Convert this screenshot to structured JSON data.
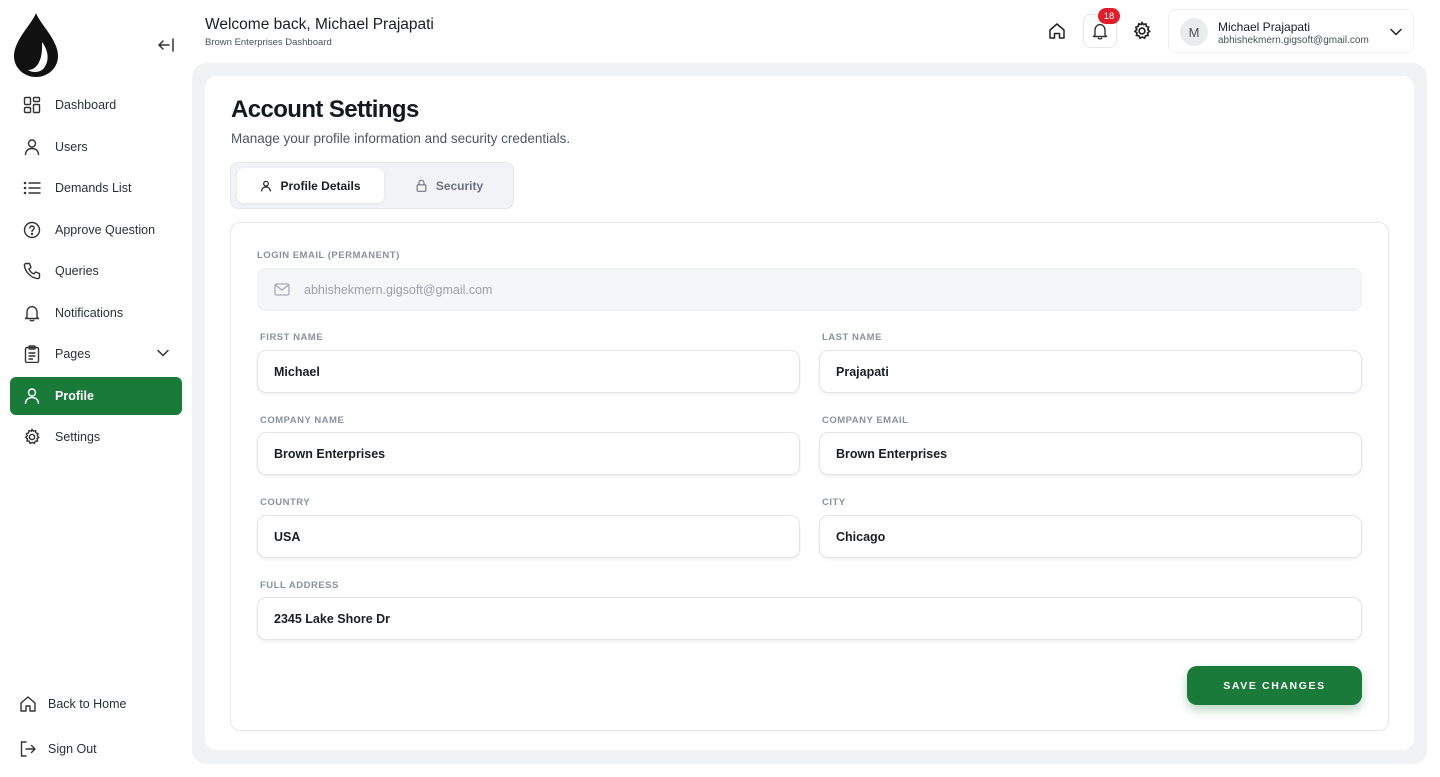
{
  "colors": {
    "accent": "#1a7a3a",
    "badge": "#e11d2a"
  },
  "sidebar": {
    "items": [
      {
        "label": "Dashboard",
        "icon": "grid-icon"
      },
      {
        "label": "Users",
        "icon": "user-icon"
      },
      {
        "label": "Demands List",
        "icon": "list-icon"
      },
      {
        "label": "Approve Question",
        "icon": "question-icon"
      },
      {
        "label": "Queries",
        "icon": "phone-icon"
      },
      {
        "label": "Notifications",
        "icon": "bell-icon"
      },
      {
        "label": "Pages",
        "icon": "clipboard-icon"
      },
      {
        "label": "Profile",
        "icon": "user-icon",
        "active": true
      },
      {
        "label": "Settings",
        "icon": "gear-icon"
      }
    ],
    "back_home": "Back to Home",
    "sign_out": "Sign Out"
  },
  "header": {
    "welcome": "Welcome back, Michael Prajapati",
    "subtitle": "Brown Enterprises Dashboard",
    "notification_count": "18",
    "user": {
      "initial": "M",
      "name": "Michael Prajapati",
      "email": "abhishekmern.gigsoft@gmail.com"
    }
  },
  "page": {
    "title": "Account Settings",
    "description": "Manage your profile information and security credentials.",
    "tabs": [
      {
        "label": "Profile Details",
        "active": true
      },
      {
        "label": "Security",
        "active": false
      }
    ]
  },
  "form": {
    "login_email_label": "LOGIN EMAIL (PERMANENT)",
    "login_email": "abhishekmern.gigsoft@gmail.com",
    "first_name_label": "FIRST NAME",
    "first_name": "Michael",
    "last_name_label": "LAST NAME",
    "last_name": "Prajapati",
    "company_name_label": "COMPANY NAME",
    "company_name": "Brown Enterprises",
    "company_email_label": "COMPANY EMAIL",
    "company_email": "Brown Enterprises",
    "country_label": "COUNTRY",
    "country": "USA",
    "city_label": "CITY",
    "city": "Chicago",
    "address_label": "FULL ADDRESS",
    "address": "2345 Lake Shore Dr",
    "save_label": "SAVE CHANGES"
  }
}
